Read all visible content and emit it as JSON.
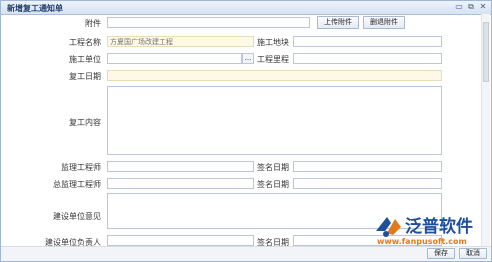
{
  "window": {
    "title": "新增复工通知单",
    "controls": [
      "restore-icon",
      "maximize-icon",
      "close-icon"
    ]
  },
  "form": {
    "attachment": {
      "label": "附件",
      "value": ""
    },
    "upload_button": "上传附件",
    "delete_button": "删退附件",
    "project_name": {
      "label": "工程名称",
      "placeholder": "方夏国广场改建工程"
    },
    "construction_site": {
      "label": "施工地块",
      "value": ""
    },
    "construction_unit": {
      "label": "施工单位",
      "value": "",
      "picker": "..."
    },
    "project_mileage": {
      "label": "工程里程",
      "value": ""
    },
    "resume_date": {
      "label": "复工日期",
      "value": ""
    },
    "resume_content": {
      "label": "复工内容",
      "value": ""
    },
    "supervisor_engineer": {
      "label": "监理工程师",
      "value": ""
    },
    "sign_date_1": {
      "label": "签名日期",
      "value": ""
    },
    "chief_supervisor": {
      "label": "总监理工程师",
      "value": ""
    },
    "sign_date_2": {
      "label": "签名日期",
      "value": ""
    },
    "owner_opinion": {
      "label": "建设单位意见",
      "value": ""
    },
    "owner_rep": {
      "label": "建设单位负责人",
      "value": ""
    },
    "sign_date_3": {
      "label": "签名日期",
      "value": ""
    }
  },
  "footer": {
    "save_button": "保存",
    "cancel_button": "取消"
  },
  "watermark": {
    "brand": "泛普软件",
    "url": "www.fanpusoft.com",
    "colors": {
      "brand": "#1d4f9b",
      "url": "#e07a1f"
    }
  }
}
